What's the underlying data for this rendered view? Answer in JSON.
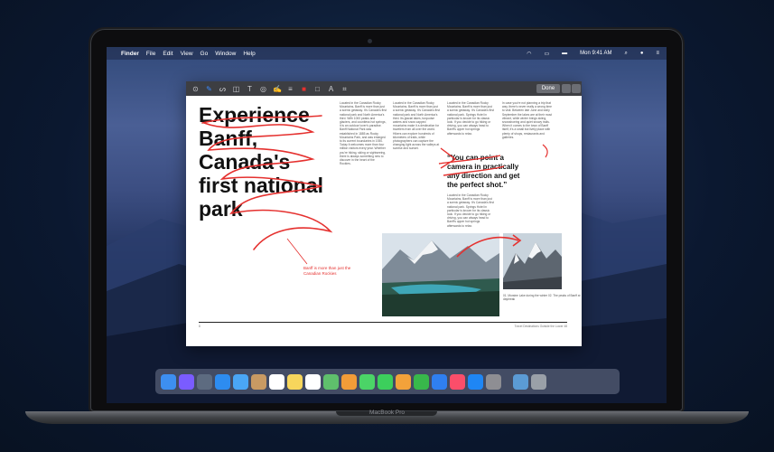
{
  "menubar": {
    "items": [
      "Finder",
      "File",
      "Edit",
      "View",
      "Go",
      "Window",
      "Help"
    ],
    "clock": "Mon 9:41 AM"
  },
  "toolbar": {
    "done_label": "Done",
    "icons": [
      "sketch-icon",
      "draw-icon",
      "shapes-icon",
      "text-icon",
      "highlight-icon",
      "sign-icon",
      "line-style-icon",
      "border-color-icon",
      "fill-color-icon",
      "font-icon",
      "crop-icon"
    ]
  },
  "document": {
    "headline_lines": [
      "Experience",
      "Banff,",
      "Canada's",
      "first national",
      "park"
    ],
    "pull_quote": "“You can point a camera in practically any direction and get the perfect shot.”",
    "annotation_note": "Banff is more than just the Canadian Rockies",
    "col1_text": "Located in the Canadian Rocky Mountains, Banff is more than just a scenic getaway. It's Canada's first national park and North America's third. With 1000 peaks and glaciers, and countless hot springs, it is an outdoor lover's paradise. Banff National Park was established in 1885 as Rocky Mountains Park, and was enlarged to its current boundaries in 1930. Today it welcomes more than four million visitors every year. Whether you're hiking, skiing or sightseeing, there is always something new to discover in the heart of the Rockies.",
    "col2_text": "Located in the Canadian Rocky Mountains, Banff is more than just a scenic getaway. It's Canada's first national park and North America's third. Its glacial lakes, turquoise waters and snow capped mountains make it a destination for travelers from all over the world. Hikers can explore hundreds of kilometers of trails, while photographers can capture the changing light across the valleys at sunrise and sunset.",
    "col3_text": "Located in the Canadian Rocky Mountains, Banff is more than just a scenic getaway. It's Canada's first national park. Springs Hotel in particular is known for its classic look. If you decide to go hiking or driving, you can always head to Banff's upper hot springs afterwards to relax.",
    "col4_text": "In case you're not planning a trip that way, there's never really a wrong time to visit. Between late June and early September the lakes are at their most vibrant, while winter brings skiing, snowshoeing and quiet snowy trails. When it comes to the town of Banff itself, it's a small but lively place with plenty of shops, restaurants and galleries.",
    "caption": "01. Moraine Lake during the winter\n02. The peaks of Banff at daybreak",
    "page_num_left": "8",
    "page_num_right": "Travel Destinations Outside the Lower 48"
  },
  "dock": {
    "icons": [
      "finder-icon",
      "siri-icon",
      "launchpad-icon",
      "safari-icon",
      "mail-icon",
      "contacts-icon",
      "calendar-icon",
      "notes-icon",
      "reminders-icon",
      "maps-icon",
      "photos-icon",
      "messages-icon",
      "facetime-icon",
      "pages-icon",
      "numbers-icon",
      "keynote-icon",
      "music-icon",
      "app-store-icon",
      "system-preferences-icon",
      "downloads-icon",
      "trash-icon"
    ],
    "colors": [
      "#3d8ff0",
      "#7a5cff",
      "#5d6b80",
      "#2d8cf0",
      "#4aa6f5",
      "#c89a63",
      "#ffffff",
      "#f7d65c",
      "#ffffff",
      "#5fbf6c",
      "#f29c38",
      "#4bd467",
      "#3ccf5c",
      "#f3a23a",
      "#38b84b",
      "#2f7ff0",
      "#fb4e6a",
      "#1e86f5",
      "#8e8e93",
      "#5b9bd5",
      "#9aa0a8"
    ]
  },
  "device": {
    "label": "MacBook Pro"
  }
}
